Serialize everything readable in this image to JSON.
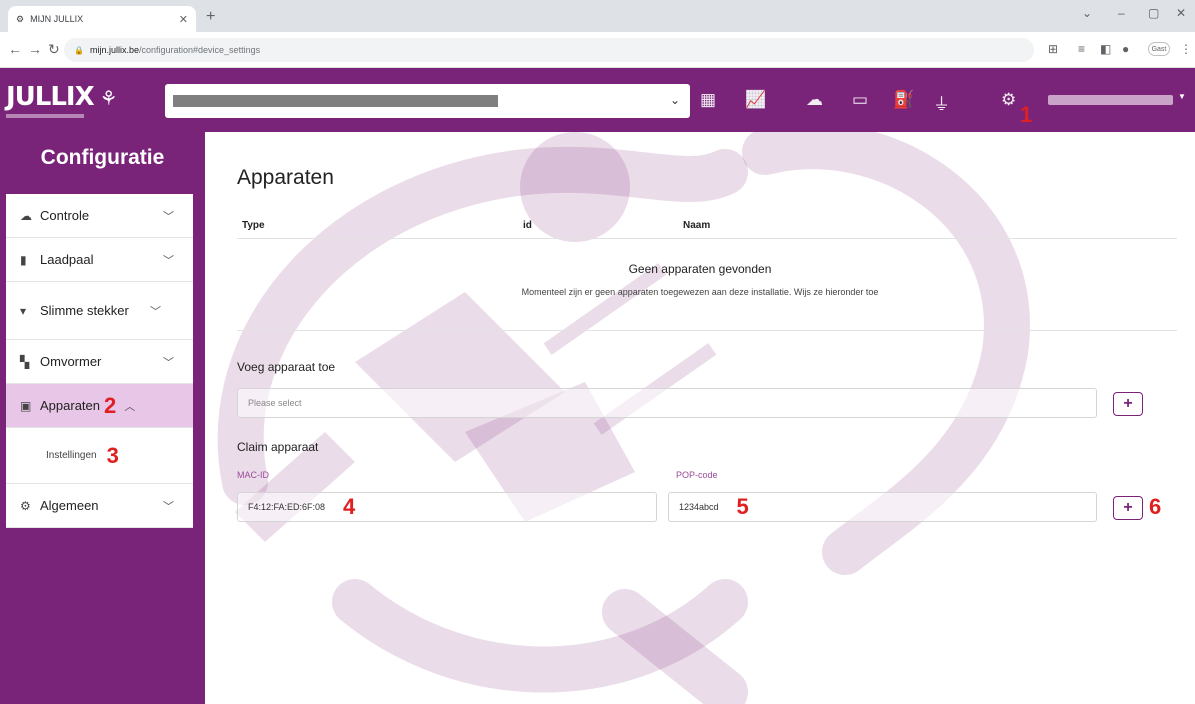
{
  "browser": {
    "tab_title": "MIJN JULLIX",
    "url_host": "mijn.jullix.be",
    "url_path": "/configuration#device_settings",
    "guest_label": "Gast"
  },
  "header": {
    "logo_text": "JULLIX",
    "icons": [
      "dashboard-icon",
      "chart-icon",
      "brain-icon",
      "money-icon",
      "charger-icon",
      "plug-icon",
      "gear-icon"
    ]
  },
  "sidebar": {
    "title": "Configuratie",
    "items": [
      {
        "label": "Controle",
        "icon": "brain-icon"
      },
      {
        "label": "Laadpaal",
        "icon": "charger-icon"
      },
      {
        "label": "Slimme stekker",
        "icon": "plug-icon"
      },
      {
        "label": "Omvormer",
        "icon": "inverter-icon"
      },
      {
        "label": "Apparaten",
        "icon": "device-icon"
      },
      {
        "label": "Algemeen",
        "icon": "gear-icon"
      }
    ],
    "sub_item": "Instellingen"
  },
  "main": {
    "title": "Apparaten",
    "columns": [
      "Type",
      "id",
      "Naam"
    ],
    "empty_title": "Geen apparaten gevonden",
    "empty_subtitle": "Momenteel zijn er geen apparaten toegewezen aan deze installatie. Wijs ze hieronder toe",
    "add_section": {
      "title": "Voeg apparaat toe",
      "placeholder": "Please select",
      "button": "+"
    },
    "claim_section": {
      "title": "Claim apparaat",
      "mac_label": "MAC-ID",
      "mac_value": "F4:12:FA:ED:6F:08",
      "pop_label": "POP-code",
      "pop_value": "1234abcd",
      "button": "+"
    }
  },
  "annotations": [
    "1",
    "2",
    "3",
    "4",
    "5",
    "6"
  ]
}
